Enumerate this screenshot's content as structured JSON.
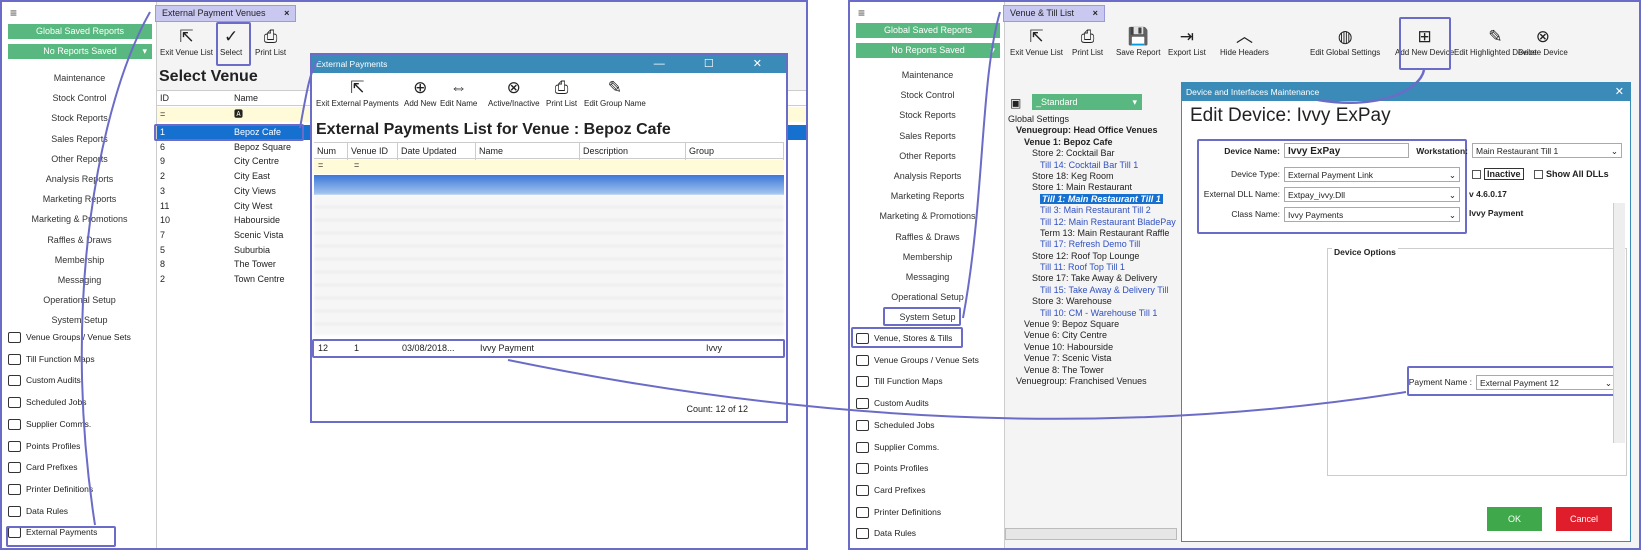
{
  "left": {
    "sidebar": {
      "hamburger": "≡",
      "global_saved": "Global Saved Reports",
      "no_reports": "No Reports Saved",
      "menu": [
        "Maintenance",
        "Stock Control",
        "Stock Reports",
        "Sales Reports",
        "Other Reports",
        "Analysis Reports",
        "Marketing Reports",
        "Marketing & Promotions",
        "Raffles & Draws",
        "Membership",
        "Messaging",
        "Operational Setup",
        "System Setup"
      ],
      "nav": [
        "Venue Groups / Venue Sets",
        "Till Function Maps",
        "Custom Audits",
        "Scheduled Jobs",
        "Supplier Comms.",
        "Points Profiles",
        "Card Prefixes",
        "Printer Definitions",
        "Data Rules",
        "External Payments"
      ]
    },
    "tab": "External Payment Venues",
    "tab_close": "×",
    "toolbar": [
      "Exit Venue List",
      "Select",
      "Print List"
    ],
    "heading": "Select Venue",
    "columns": [
      "ID",
      "Name"
    ],
    "filter": "=",
    "venues": [
      [
        "1",
        "Bepoz Cafe"
      ],
      [
        "6",
        "Bepoz Square"
      ],
      [
        "9",
        "City Centre"
      ],
      [
        "2",
        "City East"
      ],
      [
        "3",
        "City Views"
      ],
      [
        "11",
        "City West"
      ],
      [
        "10",
        "Habourside"
      ],
      [
        "7",
        "Scenic Vista"
      ],
      [
        "5",
        "Suburbia"
      ],
      [
        "8",
        "The Tower"
      ],
      [
        "2",
        "Town Centre"
      ]
    ]
  },
  "popup": {
    "title": "External Payments",
    "controls": "—  ☐  ✕",
    "toolbar": [
      "Exit External Payments",
      "Add New",
      "Edit Name",
      "Active/Inactive",
      "Print List",
      "Edit Group Name"
    ],
    "heading": "External Payments List for Venue : Bepoz Cafe",
    "columns": [
      "Num",
      "Venue ID",
      "Date Updated",
      "Name",
      "Description",
      "Group"
    ],
    "filter": "=",
    "row": {
      "num": "12",
      "venue": "1",
      "date": "03/08/2018...",
      "name": "Ivvy Payment",
      "group": "Ivvy"
    },
    "count": "Count: 12 of 12"
  },
  "right": {
    "sidebar": {
      "hamburger": "≡",
      "global_saved": "Global Saved Reports",
      "no_reports": "No Reports Saved",
      "menu": [
        "Maintenance",
        "Stock Control",
        "Stock Reports",
        "Sales Reports",
        "Other Reports",
        "Analysis Reports",
        "Marketing Reports",
        "Marketing & Promotions",
        "Raffles & Draws",
        "Membership",
        "Messaging",
        "Operational Setup",
        "System Setup"
      ],
      "nav": [
        "Venue, Stores & Tills",
        "Venue Groups / Venue Sets",
        "Till Function Maps",
        "Custom Audits",
        "Scheduled Jobs",
        "Supplier Comms.",
        "Points Profiles",
        "Card Prefixes",
        "Printer Definitions",
        "Data Rules"
      ]
    },
    "tab": "Venue & Till List",
    "tab_close": "×",
    "toolbar": [
      "Exit Venue List",
      "Print List",
      "Save Report",
      "Export List",
      "Hide Headers",
      "Edit Global Settings",
      "Add New Device",
      "Edit Highlighted Device",
      "Delete Device"
    ],
    "dropdown": "_Standard",
    "tree": [
      {
        "t": "Global Settings",
        "c": ""
      },
      {
        "t": "Venuegroup: Head Office Venues",
        "c": "bold"
      },
      {
        "t": "Venue 1: Bepoz Cafe",
        "c": "bold"
      },
      {
        "t": "Store 2: Cocktail Bar",
        "c": ""
      },
      {
        "t": "Till 14: Cocktail Bar Till 1",
        "c": "lnk"
      },
      {
        "t": "Store 18: Keg Room",
        "c": ""
      },
      {
        "t": "Store 1: Main Restaurant",
        "c": ""
      },
      {
        "t": "Till 1: Main Restaurant Till 1",
        "c": "sel"
      },
      {
        "t": "Till 3: Main Restaurant Till 2",
        "c": "lnk"
      },
      {
        "t": "Till 12: Main Restaurant BladePay",
        "c": "lnk"
      },
      {
        "t": "Term 13: Main Restaurant Raffle",
        "c": ""
      },
      {
        "t": "Till 17: Refresh Demo Till",
        "c": "lnk"
      },
      {
        "t": "Store 12: Roof Top Lounge",
        "c": ""
      },
      {
        "t": "Till 11: Roof Top Till 1",
        "c": "lnk"
      },
      {
        "t": "Store 17: Take Away & Delivery",
        "c": ""
      },
      {
        "t": "Till 15: Take Away & Delivery Till",
        "c": "lnk"
      },
      {
        "t": "Store 3: Warehouse",
        "c": ""
      },
      {
        "t": "Till 10: CM - Warehouse Till 1",
        "c": "lnk"
      },
      {
        "t": "Venue 9: Bepoz Square",
        "c": ""
      },
      {
        "t": "Venue 6: City Centre",
        "c": ""
      },
      {
        "t": "Venue 10: Habourside",
        "c": ""
      },
      {
        "t": "Venue 7: Scenic Vista",
        "c": ""
      },
      {
        "t": "Venue 8: The Tower",
        "c": ""
      },
      {
        "t": "Venuegroup: Franchised Venues",
        "c": ""
      }
    ]
  },
  "dialog": {
    "title": "Device and Interfaces Maintenance",
    "close": "✕",
    "heading": "Edit Device: Ivvy ExPay",
    "device_name_label": "Device Name:",
    "device_name": "Ivvy ExPay",
    "workstation_label": "Workstation:",
    "workstation": "Main Restaurant Till 1",
    "device_type_label": "Device Type:",
    "device_type": "External Payment Link",
    "dll_label": "External DLL Name:",
    "dll": "Extpay_ivvy.Dll",
    "class_label": "Class Name:",
    "class": "Ivvy Payments",
    "inactive": "Inactive",
    "show_all": "Show All DLLs",
    "version": "v 4.6.0.17",
    "class_ref": "Ivvy Payment",
    "options_label": "Device Options",
    "payment_label": "Payment Name :",
    "payment": "External Payment 12",
    "ok": "OK",
    "cancel": "Cancel"
  },
  "colors": {
    "accent": "#6b6bc8",
    "green": "#58b87f",
    "title": "#3b8bb8",
    "ok": "#3ea84a",
    "cancel": "#e01d2a",
    "select": "#1570d0"
  }
}
